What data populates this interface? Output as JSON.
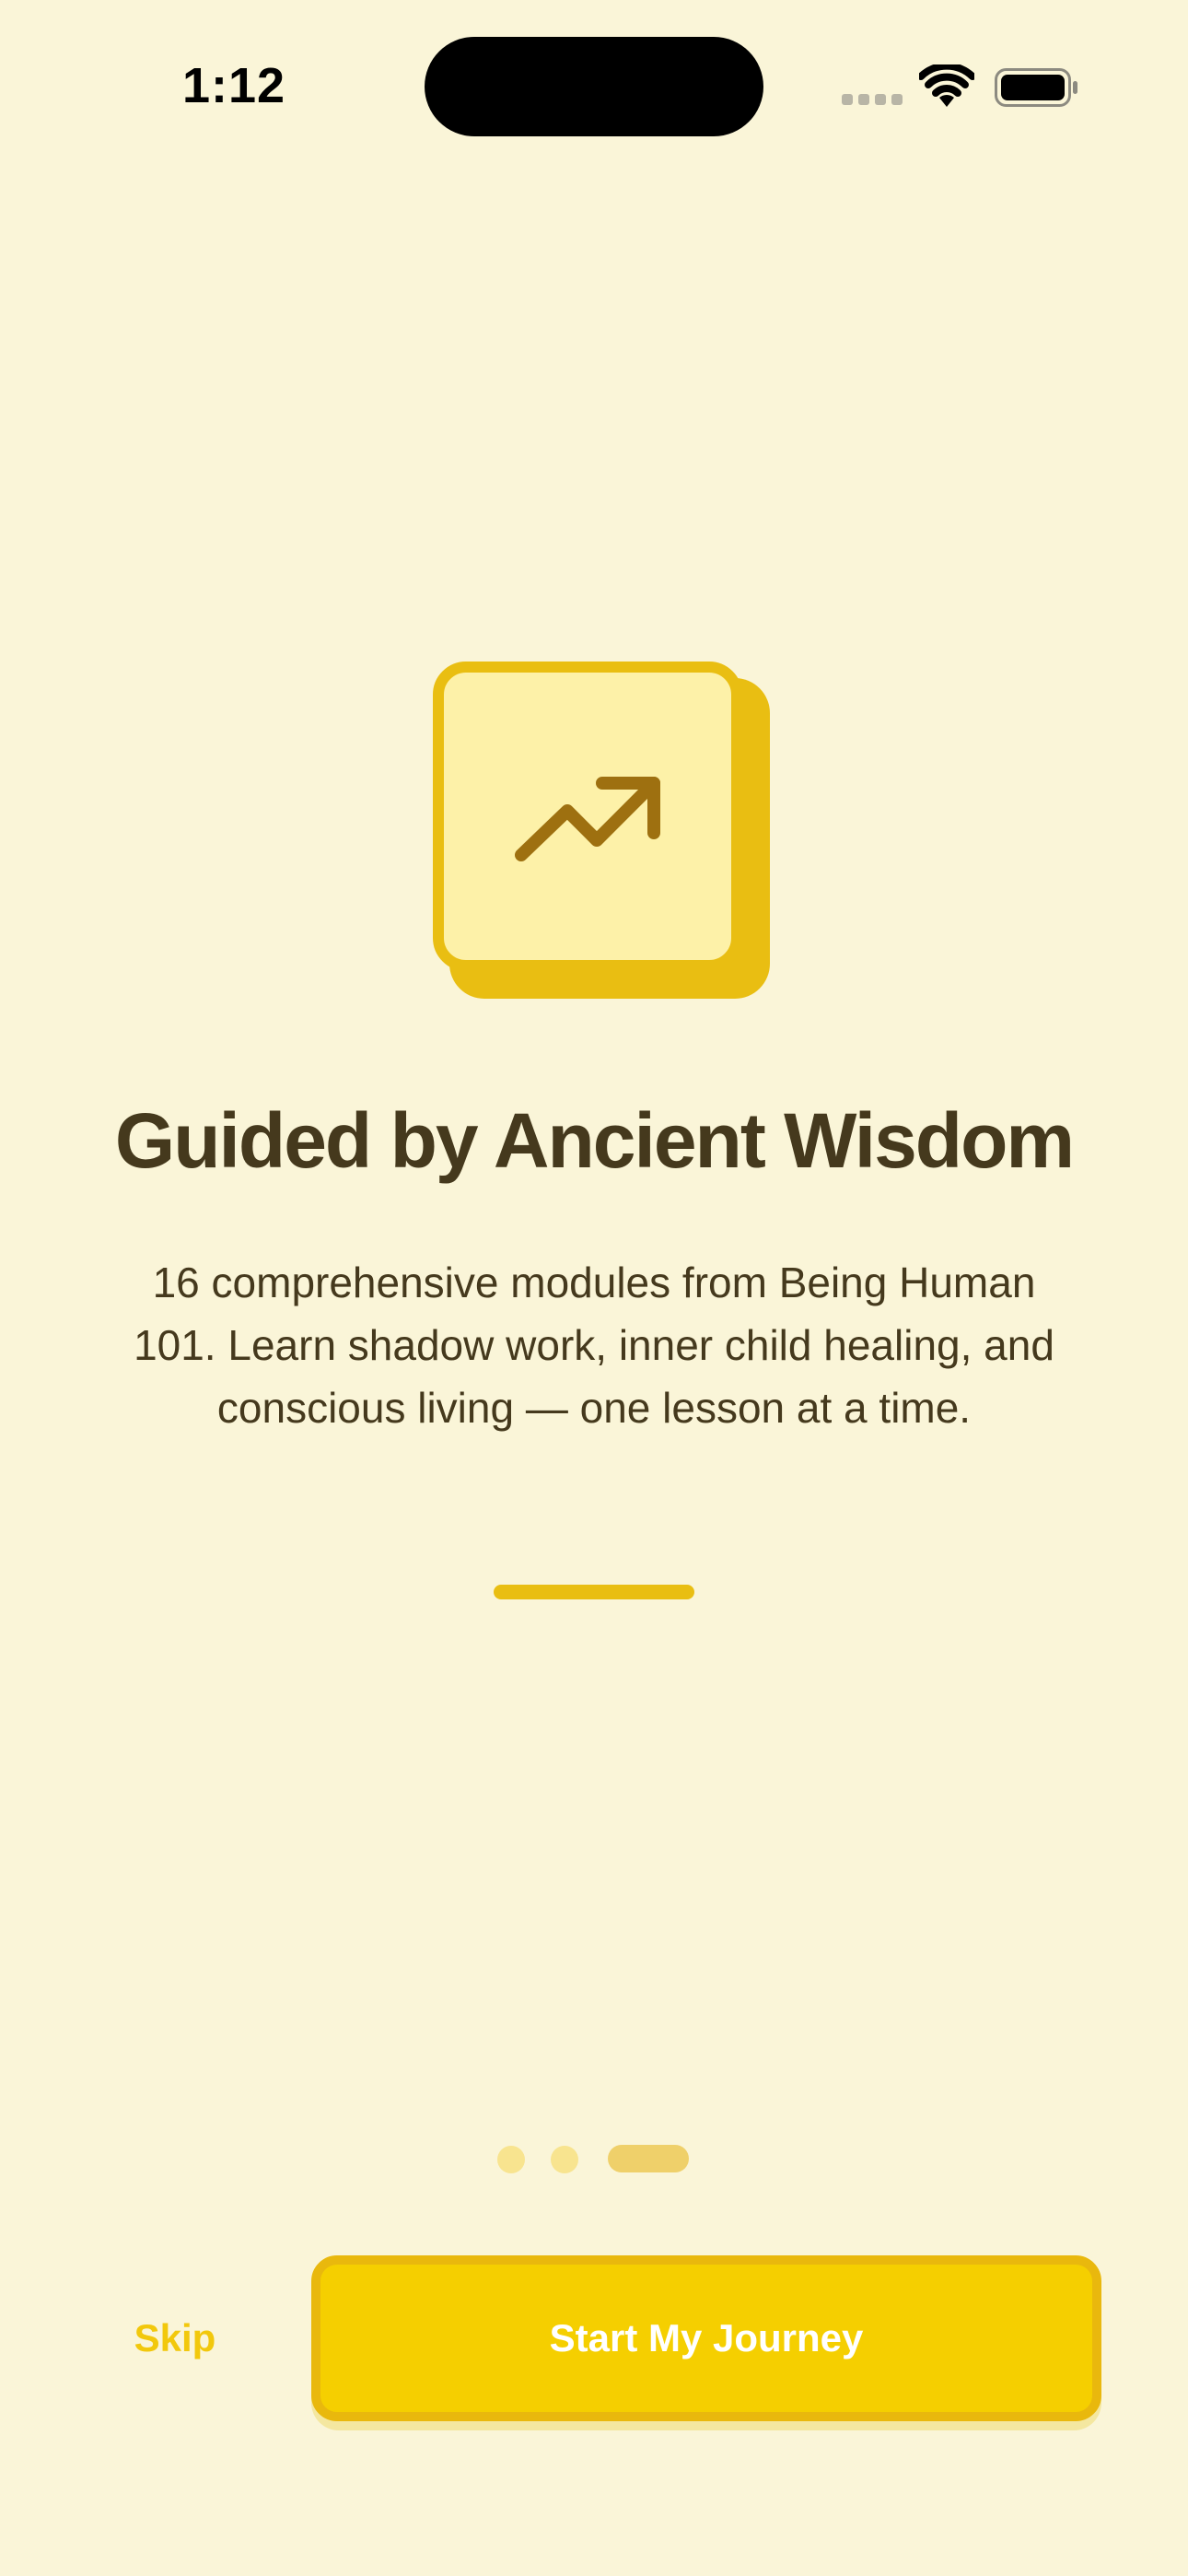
{
  "status_bar": {
    "time": "1:12",
    "signal_icon": "cellular-signal-icon",
    "wifi_icon": "wifi-icon",
    "battery_icon": "battery-full-icon"
  },
  "onboarding": {
    "hero_icon": "trending-up-icon",
    "title": "Guided by Ancient Wisdom",
    "description": "16 comprehensive modules from Being Human 101. Learn shadow work, inner child healing, and conscious living — one lesson at a time.",
    "pagination": {
      "total_pages": 3,
      "current_page": 3
    }
  },
  "actions": {
    "skip_label": "Skip",
    "primary_label": "Start My Journey"
  },
  "colors": {
    "background": "#faf5d8",
    "accent": "#f5cf00",
    "accent_dark": "#e9be12",
    "icon_fill": "#fdf1a8",
    "icon_stroke": "#9e7010",
    "text": "#45391d"
  }
}
